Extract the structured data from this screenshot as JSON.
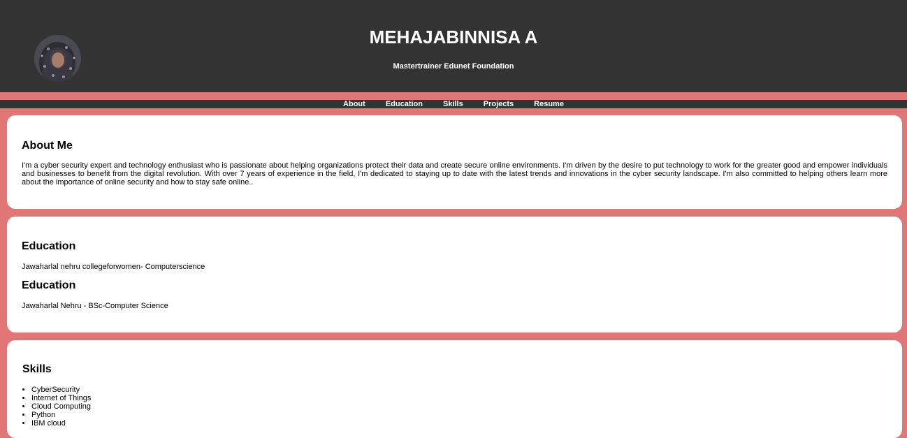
{
  "header": {
    "name": "MEHAJABINNISA A",
    "subtitle": "Mastertrainer Edunet Foundation",
    "avatar_icon": "profile-photo"
  },
  "nav": {
    "items": [
      {
        "label": "About"
      },
      {
        "label": "Education"
      },
      {
        "label": "Skills"
      },
      {
        "label": "Projects"
      },
      {
        "label": "Resume"
      }
    ]
  },
  "about": {
    "heading": "About Me",
    "text": "I'm a cyber security expert and technology enthusiast who is passionate about helping organizations protect their data and create secure online environments. I'm driven by the desire to put technology to work for the greater good and empower individuals and businesses to benefit from the digital revolution. With over 7 years of experience in the field, I'm dedicated to staying up to date with the latest trends and innovations in the cyber security landscape. I'm also committed to helping others learn more about the importance of online security and how to stay safe online.."
  },
  "education": {
    "entries": [
      {
        "heading": "Education",
        "text": "Jawaharlal nehru collegeforwomen- Computerscience"
      },
      {
        "heading": "Education",
        "text": "Jawaharlal Nehru - BSc-Computer Science"
      }
    ]
  },
  "skills": {
    "heading": "Skills",
    "items": [
      "CyberSecurity",
      "Internet of Things",
      "Cloud Computing",
      "Python",
      "IBM cloud"
    ]
  },
  "colors": {
    "header_bg": "#333333",
    "page_bg": "#e07776",
    "card_bg": "#ffffff"
  }
}
